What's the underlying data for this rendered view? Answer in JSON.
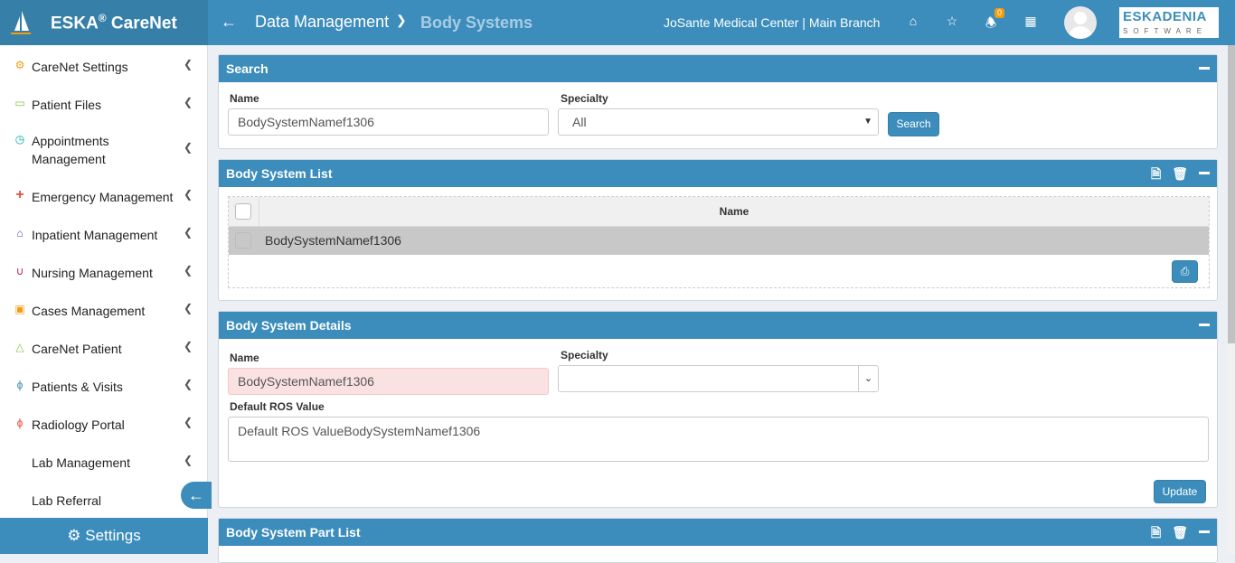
{
  "app": {
    "brand": "ESKA",
    "brand_reg": "®",
    "brand_suffix": " CareNet"
  },
  "header": {
    "crumb_parent": "Data Management",
    "crumb_current": "Body Systems",
    "center_name": "JoSante Medical Center | Main Branch",
    "notification_count": "0",
    "company_logo_line1": "ESKADENIA",
    "company_logo_line2": "SOFTWARE"
  },
  "sidebar": {
    "items": [
      {
        "label": "CareNet Settings",
        "icon": "gear-icon",
        "color": "#f39c12"
      },
      {
        "label": "Patient Files",
        "icon": "folder-open-icon",
        "color": "#8bc34a"
      },
      {
        "label": "Appointments Management",
        "icon": "clock-icon",
        "color": "#00a6a6"
      },
      {
        "label": "Emergency Management",
        "icon": "plus-icon",
        "color": "#e74c3c"
      },
      {
        "label": "Inpatient Management",
        "icon": "home-icon",
        "color": "#5b3fa8"
      },
      {
        "label": "Nursing Management",
        "icon": "stethoscope-icon",
        "color": "#c2185b"
      },
      {
        "label": "Cases Management",
        "icon": "image-icon",
        "color": "#f39c12"
      },
      {
        "label": "CareNet Patient",
        "icon": "flask-icon",
        "color": "#8bc34a"
      },
      {
        "label": "Patients & Visits",
        "icon": "bolt-icon",
        "color": "#3c8dbc"
      },
      {
        "label": "Radiology Portal",
        "icon": "bolt-icon",
        "color": "#e74c3c"
      },
      {
        "label": "Lab Management",
        "icon": "",
        "color": "#333"
      },
      {
        "label": "Lab Referral",
        "icon": "",
        "color": "#333"
      }
    ],
    "settings_label": "Settings"
  },
  "search_panel": {
    "title": "Search",
    "name_label": "Name",
    "name_value": "BodySystemNamef1306",
    "specialty_label": "Specialty",
    "specialty_value": "All",
    "search_button": "Search"
  },
  "list_panel": {
    "title": "Body System List",
    "column_name": "Name",
    "rows": [
      {
        "name": "BodySystemNamef1306"
      }
    ]
  },
  "details_panel": {
    "title": "Body System Details",
    "name_label": "Name",
    "name_value": "BodySystemNamef1306",
    "specialty_label": "Specialty",
    "specialty_value": "",
    "ros_label": "Default ROS Value",
    "ros_value": "Default ROS ValueBodySystemNamef1306",
    "update_button": "Update"
  },
  "part_list_panel": {
    "title": "Body System Part List"
  }
}
